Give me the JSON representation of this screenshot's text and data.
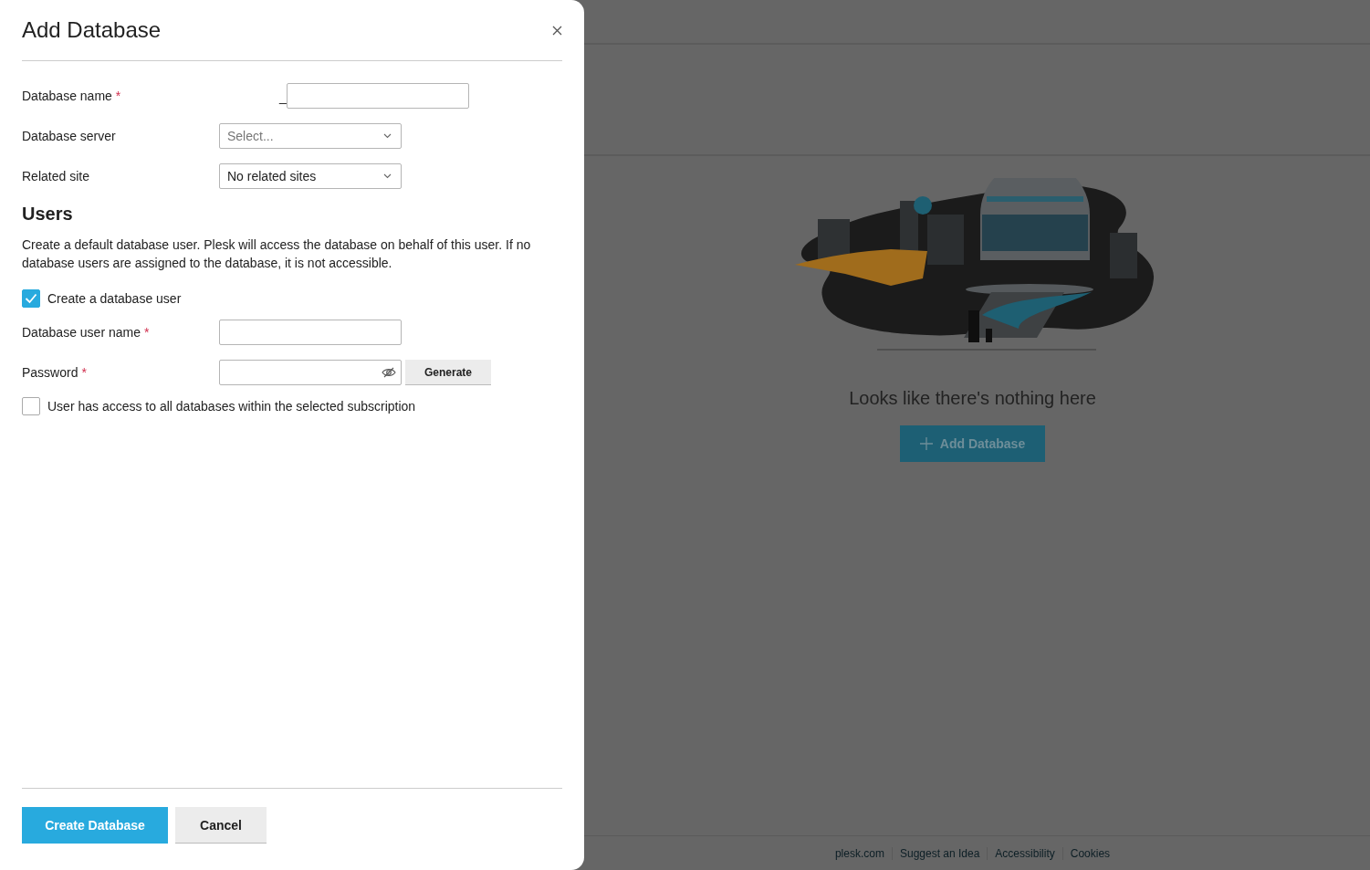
{
  "dialog": {
    "title": "Add Database",
    "fields": [
      {
        "kind": "text",
        "label": "Database name",
        "required_mark": "*",
        "prefix": "_"
      },
      {
        "kind": "select",
        "label": "Database server",
        "placeholder": "Select..."
      },
      {
        "kind": "select",
        "label": "Related site",
        "value": "No related sites"
      }
    ],
    "users": {
      "title": "Users",
      "description": "Create a default database user. Plesk will access the database on behalf of this user. If no database users are assigned to the database, it is not accessible.",
      "create_user": {
        "label": "Create a database user",
        "checked": true
      },
      "fields": [
        {
          "kind": "text",
          "label": "Database user name",
          "required_mark": "*"
        },
        {
          "kind": "password",
          "label": "Password",
          "required_mark": "*",
          "action": "Generate"
        }
      ],
      "access_all": {
        "label": "User has access to all databases within the selected subscription",
        "checked": false
      }
    },
    "buttons": [
      {
        "label": "Create Database",
        "kind": "primary"
      },
      {
        "label": "Cancel",
        "kind": "secondary"
      }
    ]
  },
  "empty_state": {
    "message": "Looks like there's nothing here",
    "button": "Add Database"
  },
  "footer_links": [
    "plesk.com",
    "Suggest an Idea",
    "Accessibility",
    "Cookies"
  ]
}
